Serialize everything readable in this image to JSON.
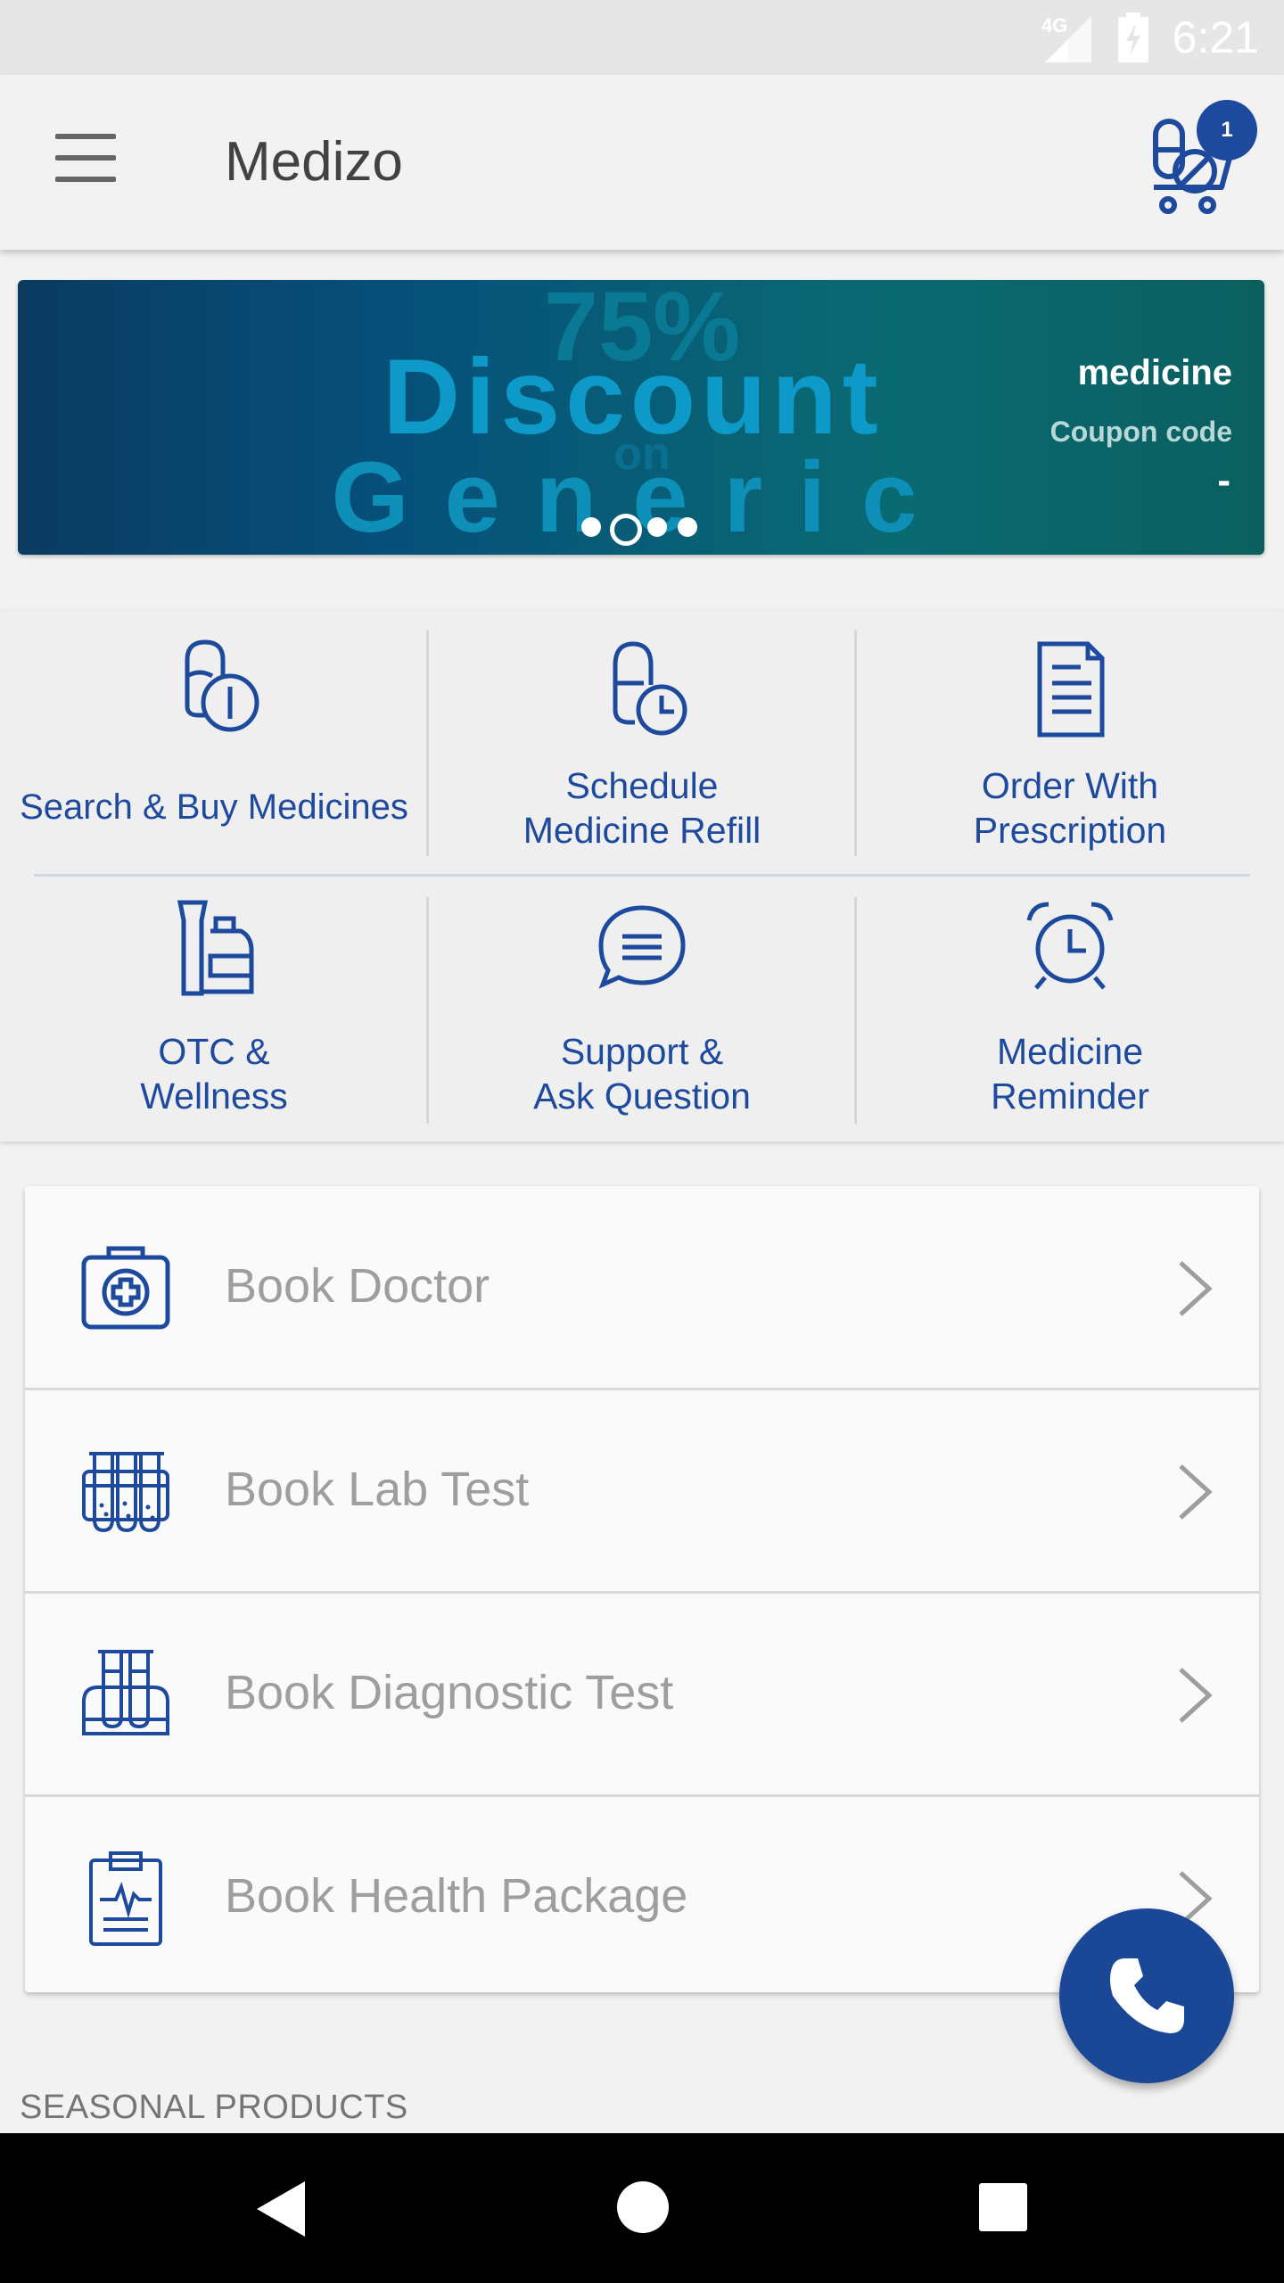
{
  "status_bar": {
    "network": "4G",
    "time": "6:21"
  },
  "toolbar": {
    "title": "Medizo",
    "cart_count": "1"
  },
  "banner": {
    "headline_1": "75%",
    "headline_2": "Discount",
    "headline_3": "on",
    "headline_4": "Generic",
    "side_title": "medicine",
    "side_subtitle": "Coupon code",
    "side_code": "-",
    "slide_count": 4,
    "active_slide": 2
  },
  "quick_actions": [
    {
      "label": "Search & Buy Medicines",
      "icon": "pills-icon"
    },
    {
      "label_1": "Schedule",
      "label_2": "Medicine Refill",
      "icon": "capsule-clock-icon"
    },
    {
      "label_1": "Order With",
      "label_2": "Prescription",
      "icon": "prescription-document-icon"
    },
    {
      "label_1": "OTC &",
      "label_2": "Wellness",
      "icon": "wellness-products-icon"
    },
    {
      "label_1": "Support &",
      "label_2": "Ask Question",
      "icon": "chat-bubble-icon"
    },
    {
      "label_1": "Medicine",
      "label_2": "Reminder",
      "icon": "alarm-clock-icon"
    }
  ],
  "book_list": [
    {
      "label": "Book Doctor",
      "icon": "medical-kit-icon"
    },
    {
      "label": "Book Lab Test",
      "icon": "test-tubes-icon"
    },
    {
      "label": "Book Diagnostic Test",
      "icon": "diagnostic-tubes-icon"
    },
    {
      "label": "Book Health Package",
      "icon": "clipboard-pulse-icon"
    }
  ],
  "section_seasonal": "SEASONAL PRODUCTS",
  "colors": {
    "primary": "#1e4a9e",
    "fab": "#1a4896",
    "muted_text": "#9e9e9e"
  }
}
